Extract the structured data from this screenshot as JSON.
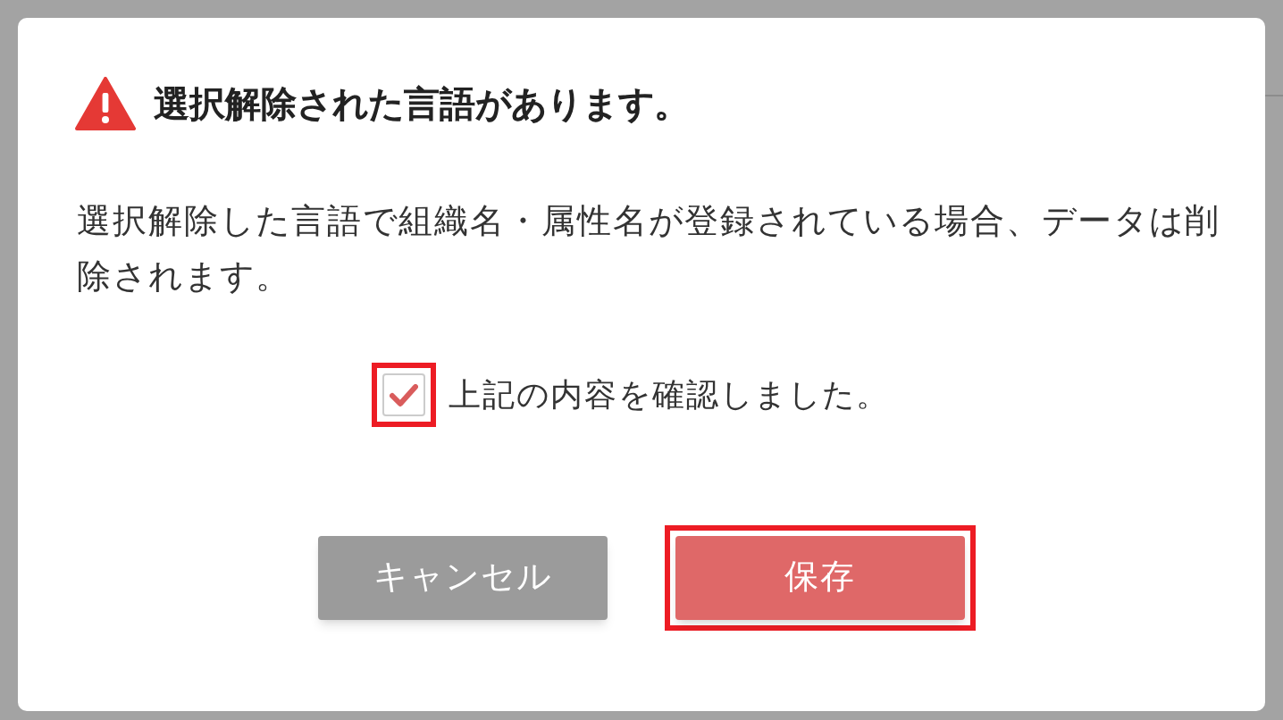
{
  "dialog": {
    "title": "選択解除された言語があります。",
    "message": "選択解除した言語で組織名・属性名が登録されている場合、データは削除されます。"
  },
  "confirm": {
    "label": "上記の内容を確認しました。",
    "checked": true,
    "highlighted": true
  },
  "buttons": [
    {
      "label": "キャンセル",
      "kind": "cancel",
      "highlighted": false
    },
    {
      "label": "保存",
      "kind": "save",
      "highlighted": true
    }
  ]
}
